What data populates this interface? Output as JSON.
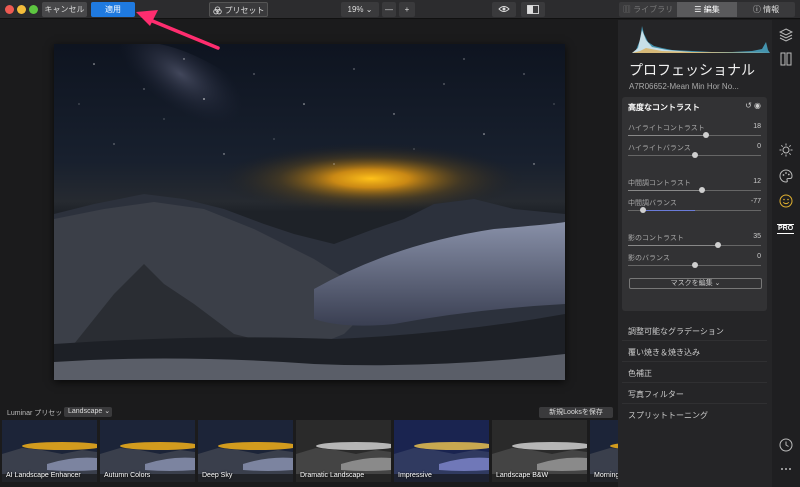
{
  "toolbar": {
    "cancel_label": "キャンセル",
    "apply_label": "適用",
    "preset_label": "プリセット",
    "zoom_label": "19% ⌄",
    "zoom_minus": "—",
    "zoom_plus": "+",
    "tabs": [
      {
        "label": "ライブラリ",
        "icon": "library-icon"
      },
      {
        "label": "編集",
        "icon": "sliders-icon"
      },
      {
        "label": "情報",
        "icon": "info-icon"
      }
    ]
  },
  "sidebar": {
    "panel_title": "プロフェッショナル",
    "filename": "A7R06652-Mean Min Hor No...",
    "advanced_contrast": {
      "title": "高度なコントラスト",
      "sliders": [
        {
          "label": "ハイライトコントラスト",
          "value": "18",
          "level": 0.59
        },
        {
          "label": "ハイライトバランス",
          "value": "0",
          "level": 0.5
        },
        {
          "label": "中間調コントラスト",
          "value": "12",
          "level": 0.56
        },
        {
          "label": "中間調バランス",
          "value": "-77",
          "level": 0.115
        },
        {
          "label": "影のコントラスト",
          "value": "35",
          "level": 0.675
        },
        {
          "label": "影のバランス",
          "value": "0",
          "level": 0.5
        }
      ],
      "mask_button": "マスクを編集 ⌄"
    },
    "sections": [
      "調整可能なグラデーション",
      "覆い焼き＆焼き込み",
      "色補正",
      "写真フィルター",
      "スプリットトーニング"
    ]
  },
  "icon_strip": {
    "pro_label": "PRO",
    "icons": [
      "layers-icon",
      "canvas-icon",
      "sun-icon",
      "palette-icon",
      "smile-icon",
      "history-icon",
      "more-icon"
    ]
  },
  "presets": {
    "label": "Luminar プリセット",
    "category": "Landscape",
    "save_button": "新規Looksを保存",
    "items": [
      {
        "name": "AI Landscape Enhancer",
        "style": "color"
      },
      {
        "name": "Autumn Colors",
        "style": "color"
      },
      {
        "name": "Deep Sky",
        "style": "color"
      },
      {
        "name": "Dramatic Landscape",
        "style": "mono"
      },
      {
        "name": "Impressive",
        "style": "blue"
      },
      {
        "name": "Landscape B&W",
        "style": "mono"
      },
      {
        "name": "Morning F",
        "style": "color"
      }
    ]
  },
  "colors": {
    "accent": "#1f7ae0",
    "slider_fill": "#6a7bd8",
    "annotation_arrow": "#ff2d6f"
  }
}
